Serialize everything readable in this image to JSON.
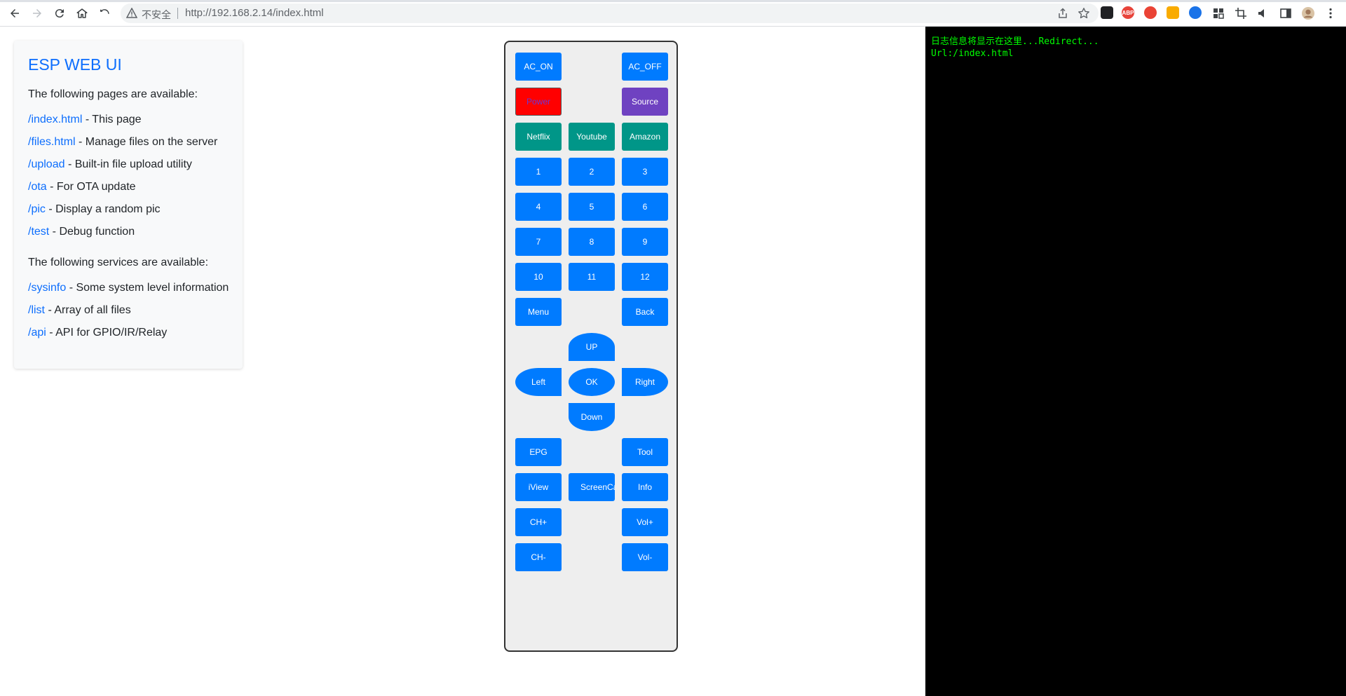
{
  "browser": {
    "security_label": "不安全",
    "url": "http://192.168.2.14/index.html",
    "extensions": [
      {
        "name": "ext-1",
        "label": "",
        "color": "#202124"
      },
      {
        "name": "adblock-plus",
        "label": "ABP",
        "color": "#e8443b"
      },
      {
        "name": "ext-3",
        "label": "",
        "color": "#ea4335"
      },
      {
        "name": "ext-4",
        "label": "",
        "color": "#f9ab00"
      },
      {
        "name": "ext-5",
        "label": "",
        "color": "#1a73e8"
      }
    ]
  },
  "info_card": {
    "title": "ESP WEB UI",
    "pages_intro": "The following pages are available:",
    "pages": [
      {
        "link": "/index.html",
        "desc": " - This page"
      },
      {
        "link": "/files.html",
        "desc": " - Manage files on the server"
      },
      {
        "link": "/upload",
        "desc": " - Built-in file upload utility"
      },
      {
        "link": "/ota",
        "desc": " - For OTA update"
      },
      {
        "link": "/pic",
        "desc": " - Display a random pic"
      },
      {
        "link": "/test",
        "desc": " - Debug function"
      }
    ],
    "services_intro": "The following services are available:",
    "services": [
      {
        "link": "/sysinfo",
        "desc": " - Some system level information"
      },
      {
        "link": "/list",
        "desc": " - Array of all files"
      },
      {
        "link": "/api",
        "desc": " - API for GPIO/IR/Relay"
      }
    ]
  },
  "remote": {
    "ac_on": "AC_ON",
    "ac_off": "AC_OFF",
    "power": "Power",
    "source": "Source",
    "netflix": "Netflix",
    "youtube": "Youtube",
    "amazon": "Amazon",
    "digits": [
      "1",
      "2",
      "3",
      "4",
      "5",
      "6",
      "7",
      "8",
      "9",
      "10",
      "11",
      "12"
    ],
    "menu": "Menu",
    "back": "Back",
    "up": "UP",
    "left": "Left",
    "ok": "OK",
    "right": "Right",
    "down": "Down",
    "epg": "EPG",
    "tool": "Tool",
    "iview": "iView",
    "screencast": "ScreenCast",
    "info": "Info",
    "ch_up": "CH+",
    "vol_up": "Vol+",
    "ch_down": "CH-",
    "vol_down": "Vol-"
  },
  "console": {
    "line1": "日志信息将显示在这里...Redirect...",
    "line2": "Url:/index.html"
  },
  "colors": {
    "primary": "#007bff",
    "link": "#0d6efd",
    "power_bg": "#ff0000",
    "source_bg": "#6f42c1",
    "streaming_bg": "#009688",
    "console_text": "#00ff00"
  }
}
